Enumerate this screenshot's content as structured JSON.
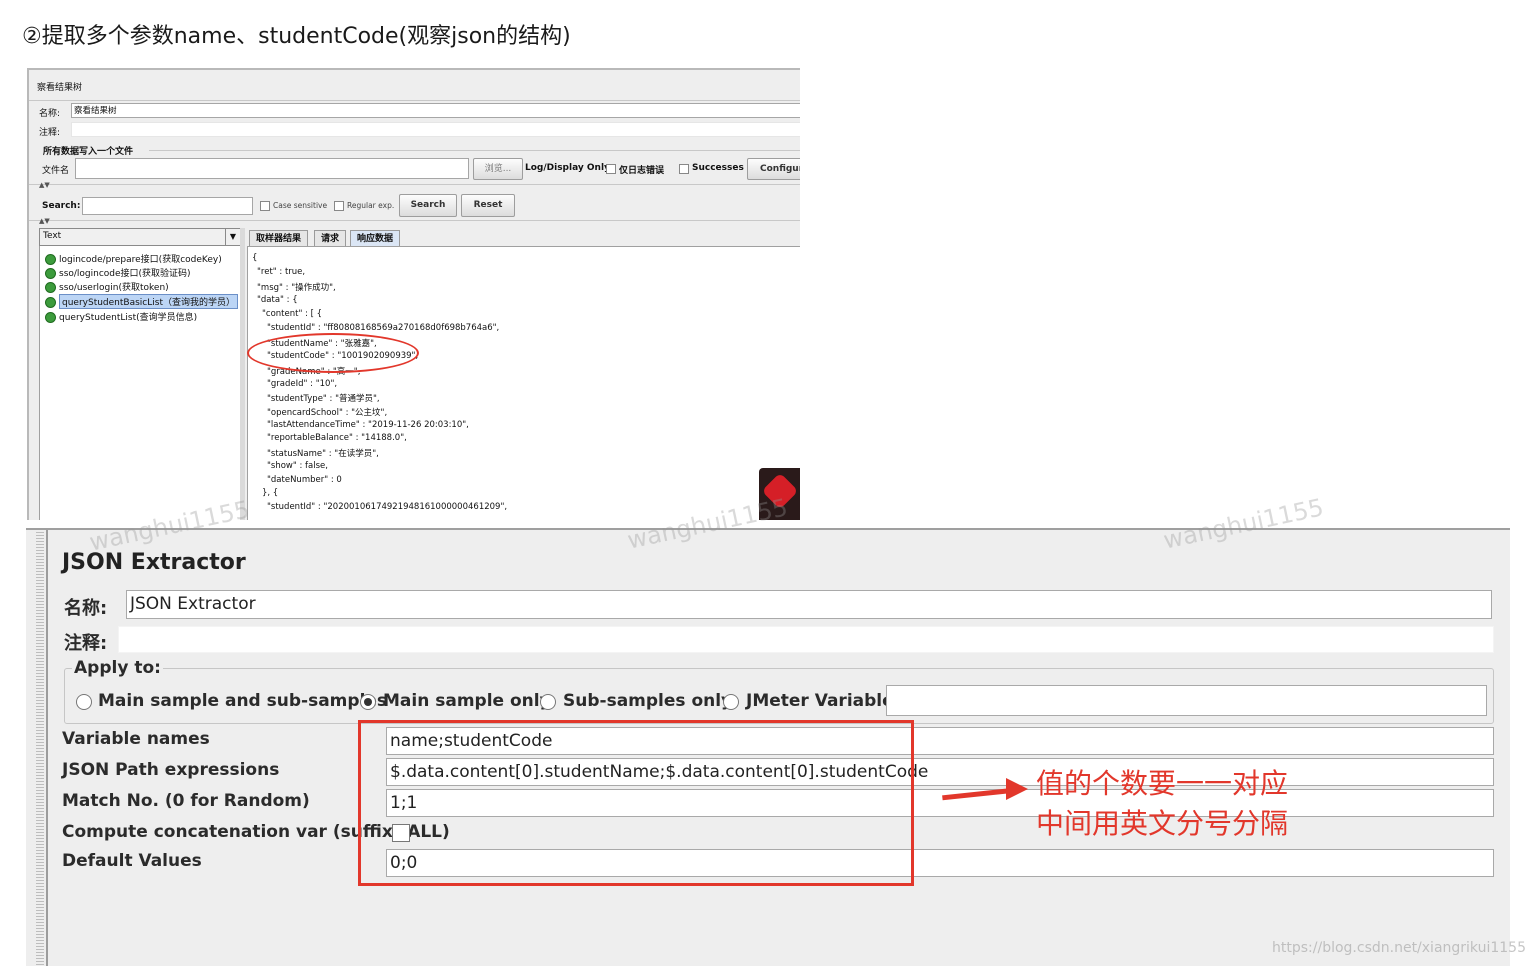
{
  "heading": "②提取多个参数name、studentCode(观察json的结构)",
  "view_results_tree": {
    "title": "察看结果树",
    "name_label": "名称:",
    "name_value": "察看结果树",
    "comment_label": "注释:",
    "write_section": "所有数据写入一个文件",
    "filename_label": "文件名",
    "browse_label": "浏览...",
    "log_display_label": "Log/Display Only:",
    "errors_only_label": "仅日志错误",
    "successes_label": "Successes",
    "configure_label": "Configure",
    "search_label": "Search:",
    "case_sensitive_label": "Case sensitive",
    "regular_exp_label": "Regular exp.",
    "search_button": "Search",
    "reset_button": "Reset",
    "renderer_value": "Text",
    "tree_items": [
      "logincode/prepare接口(获取codeKey)",
      "sso/logincode接口(获取验证码)",
      "sso/userlogin(获取token)",
      "queryStudentBasicList（查询我的学员）",
      "queryStudentList(查询学员信息)"
    ],
    "tabs": [
      "取样器结果",
      "请求",
      "响应数据"
    ],
    "json_lines": [
      "{",
      "\"ret\" : true,",
      "\"msg\" : \"操作成功\",",
      "\"data\" : {",
      "\"content\" : [ {",
      "\"studentId\" : \"ff80808168569a270168d0f698b764a6\",",
      "\"studentName\" : \"张雅嘉\",",
      "\"studentCode\" : \"1001902090939\",",
      "\"gradeName\" : \"高一\",",
      "\"gradeId\" : \"10\",",
      "\"studentType\" : \"普通学员\",",
      "\"opencardSchool\" : \"公主坟\",",
      "\"lastAttendanceTime\" : \"2019-11-26 20:03:10\",",
      "\"reportableBalance\" : \"14188.0\",",
      "\"statusName\" : \"在读学员\",",
      "\"show\" : false,",
      "\"dateNumber\" : 0",
      "}, {",
      "\"studentId\" : \"20200106174921948161000000461209\","
    ]
  },
  "json_extractor": {
    "title": "JSON Extractor",
    "name_label": "名称:",
    "name_value": "JSON Extractor",
    "comment_label": "注释:",
    "apply_to_label": "Apply to:",
    "radio_options": [
      "Main sample and sub-samples",
      "Main sample only",
      "Sub-samples only",
      "JMeter Variable"
    ],
    "selected_option": "Main sample only",
    "variable_names_label": "Variable names",
    "variable_names_value": "name;studentCode",
    "json_path_label": "JSON Path expressions",
    "json_path_value": "$.data.content[0].studentName;$.data.content[0].studentCode",
    "match_no_label": "Match No. (0 for Random)",
    "match_no_value": "1;1",
    "concat_label": "Compute concatenation var (suffix _ALL)",
    "default_values_label": "Default Values",
    "default_values_value": "0;0"
  },
  "annotation": {
    "line1": "值的个数要一一对应",
    "line2": "中间用英文分号分隔",
    "color": "#e2372b"
  },
  "watermarks": [
    "wanghui1155",
    "wanghui1155",
    "wanghui1155"
  ],
  "credit": "https://blog.csdn.net/xiangrikui1155"
}
